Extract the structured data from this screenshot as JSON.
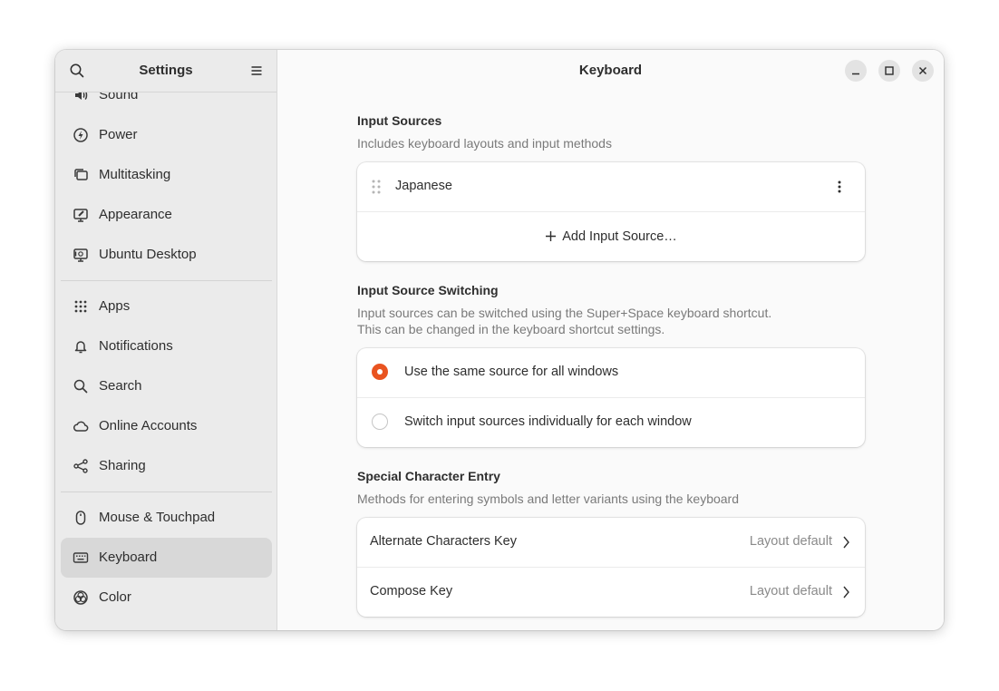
{
  "sidebar": {
    "title": "Settings",
    "search_icon": "search-icon",
    "menu_icon": "hamburger-menu-icon",
    "groups": [
      [
        {
          "label": "Sound",
          "icon": "speaker-icon"
        },
        {
          "label": "Power",
          "icon": "power-icon"
        },
        {
          "label": "Multitasking",
          "icon": "multitasking-icon"
        },
        {
          "label": "Appearance",
          "icon": "appearance-icon"
        },
        {
          "label": "Ubuntu Desktop",
          "icon": "ubuntu-desktop-icon"
        }
      ],
      [
        {
          "label": "Apps",
          "icon": "apps-grid-icon"
        },
        {
          "label": "Notifications",
          "icon": "bell-icon"
        },
        {
          "label": "Search",
          "icon": "search-icon"
        },
        {
          "label": "Online Accounts",
          "icon": "cloud-icon"
        },
        {
          "label": "Sharing",
          "icon": "share-icon"
        }
      ],
      [
        {
          "label": "Mouse & Touchpad",
          "icon": "mouse-icon"
        },
        {
          "label": "Keyboard",
          "icon": "keyboard-icon",
          "active": true
        },
        {
          "label": "Color",
          "icon": "color-icon"
        }
      ]
    ]
  },
  "main": {
    "title": "Keyboard",
    "window_controls": [
      "minimize-icon",
      "maximize-icon",
      "close-icon"
    ],
    "input_sources": {
      "title": "Input Sources",
      "subtitle": "Includes keyboard layouts and input methods",
      "sources": [
        {
          "label": "Japanese"
        }
      ],
      "add_label": "Add Input Source…"
    },
    "switching": {
      "title": "Input Source Switching",
      "subtitle_line1": "Input sources can be switched using the Super+Space keyboard shortcut.",
      "subtitle_line2": "This can be changed in the keyboard shortcut settings.",
      "options": [
        {
          "label": "Use the same source for all windows",
          "selected": true
        },
        {
          "label": "Switch input sources individually for each window",
          "selected": false
        }
      ]
    },
    "special": {
      "title": "Special Character Entry",
      "subtitle": "Methods for entering symbols and letter variants using the keyboard",
      "rows": [
        {
          "label": "Alternate Characters Key",
          "value": "Layout default"
        },
        {
          "label": "Compose Key",
          "value": "Layout default"
        }
      ]
    }
  },
  "colors": {
    "accent": "#e95420",
    "sidebar_bg": "#ebebeb",
    "sidebar_active": "#d8d8d8",
    "content_bg": "#fafafa"
  }
}
